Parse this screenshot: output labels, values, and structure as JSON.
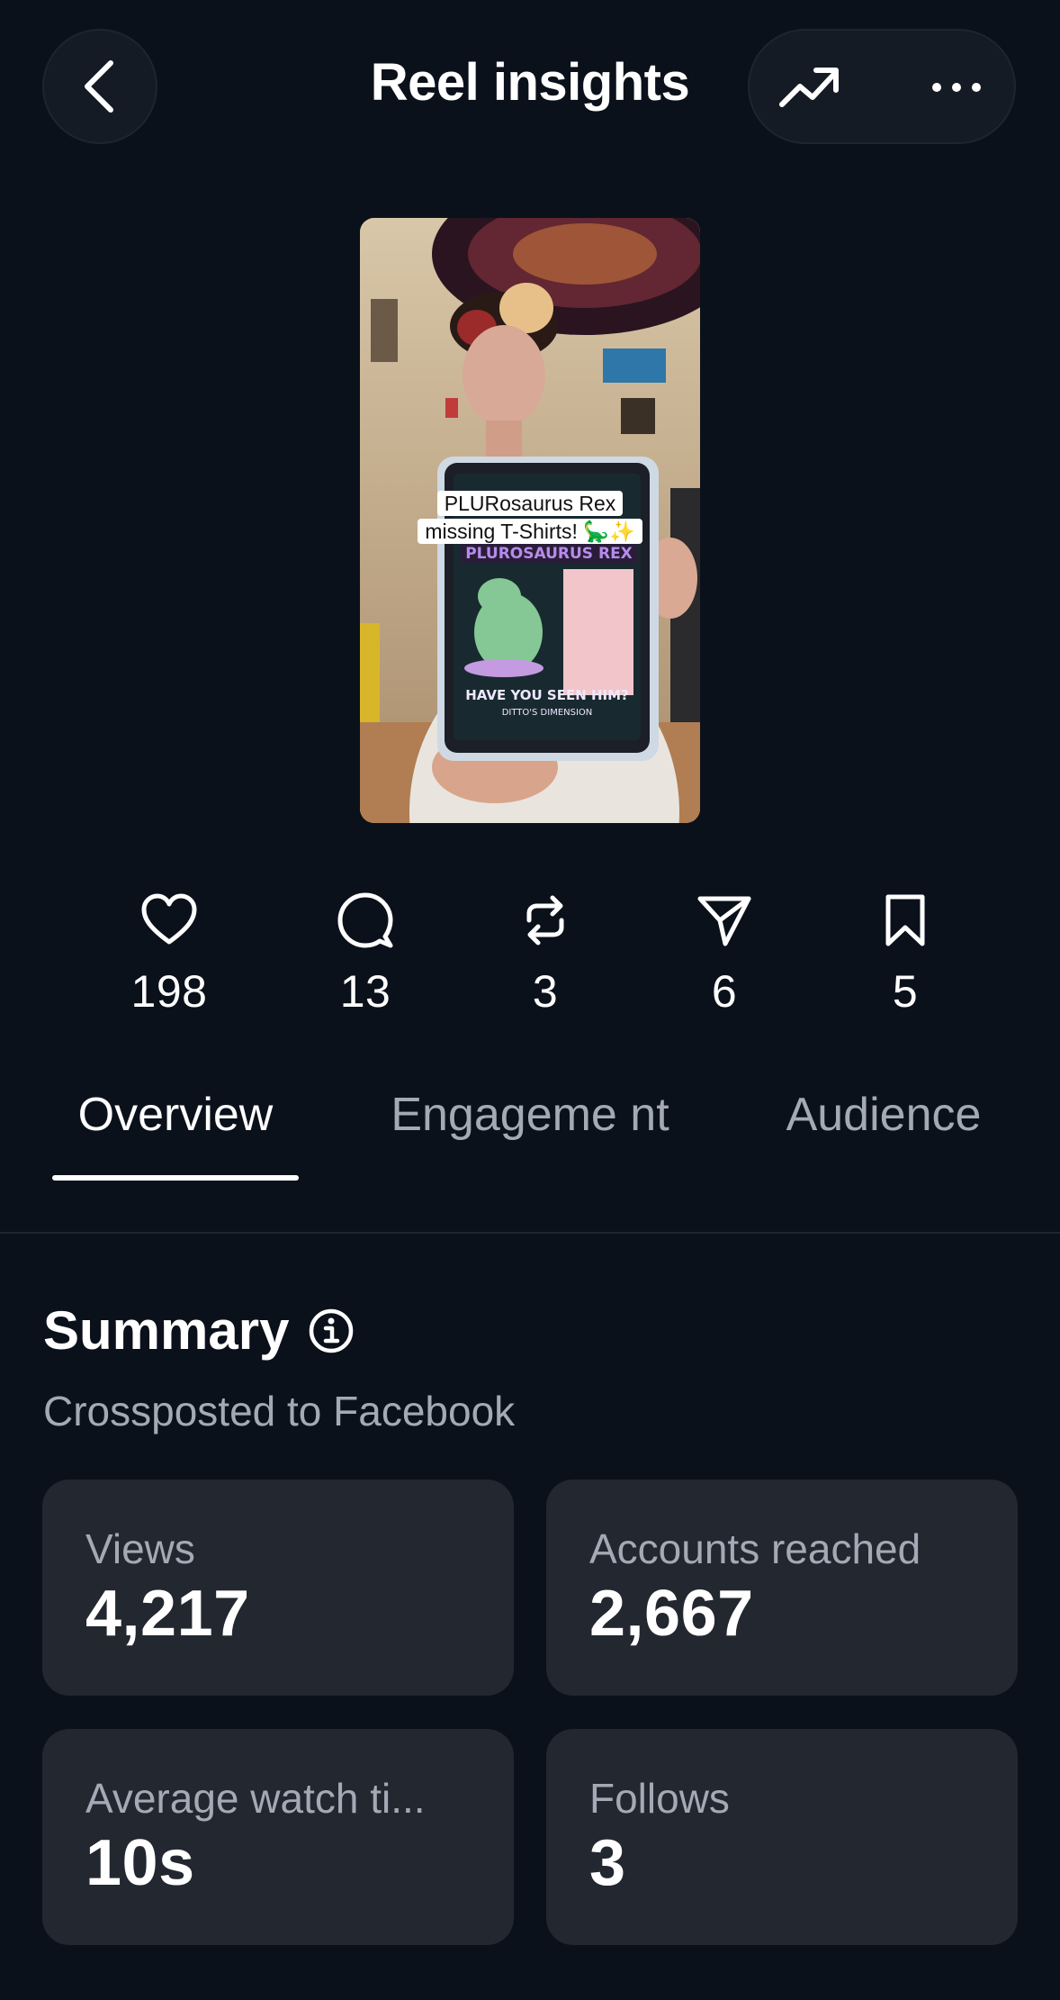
{
  "header": {
    "title": "Reel insights",
    "back_icon": "chevron-left-icon",
    "trend_icon": "trending-up-icon",
    "more_icon": "more-horizontal-icon"
  },
  "reel": {
    "caption_line1": "PLURosaurus Rex",
    "caption_line2": "missing T-Shirts! 🦕✨"
  },
  "stats": [
    {
      "icon": "heart-icon",
      "value": "198"
    },
    {
      "icon": "comment-icon",
      "value": "13"
    },
    {
      "icon": "repost-icon",
      "value": "3"
    },
    {
      "icon": "share-icon",
      "value": "6"
    },
    {
      "icon": "bookmark-icon",
      "value": "5"
    }
  ],
  "tabs": [
    {
      "label": "Overview",
      "active": true
    },
    {
      "label": "Engageme nt",
      "active": false
    },
    {
      "label": "Audience",
      "active": false
    }
  ],
  "summary": {
    "title": "Summary",
    "subtitle": "Crossposted to Facebook",
    "cards": [
      {
        "label": "Views",
        "value": "4,217"
      },
      {
        "label": "Accounts reached",
        "value": "2,667"
      },
      {
        "label": "Average watch ti...",
        "value": "10s"
      },
      {
        "label": "Follows",
        "value": "3"
      }
    ]
  },
  "colors": {
    "background": "#0b111b",
    "card": "#222730",
    "secondary_text": "#a3aab5",
    "primary_text": "#ffffff"
  }
}
